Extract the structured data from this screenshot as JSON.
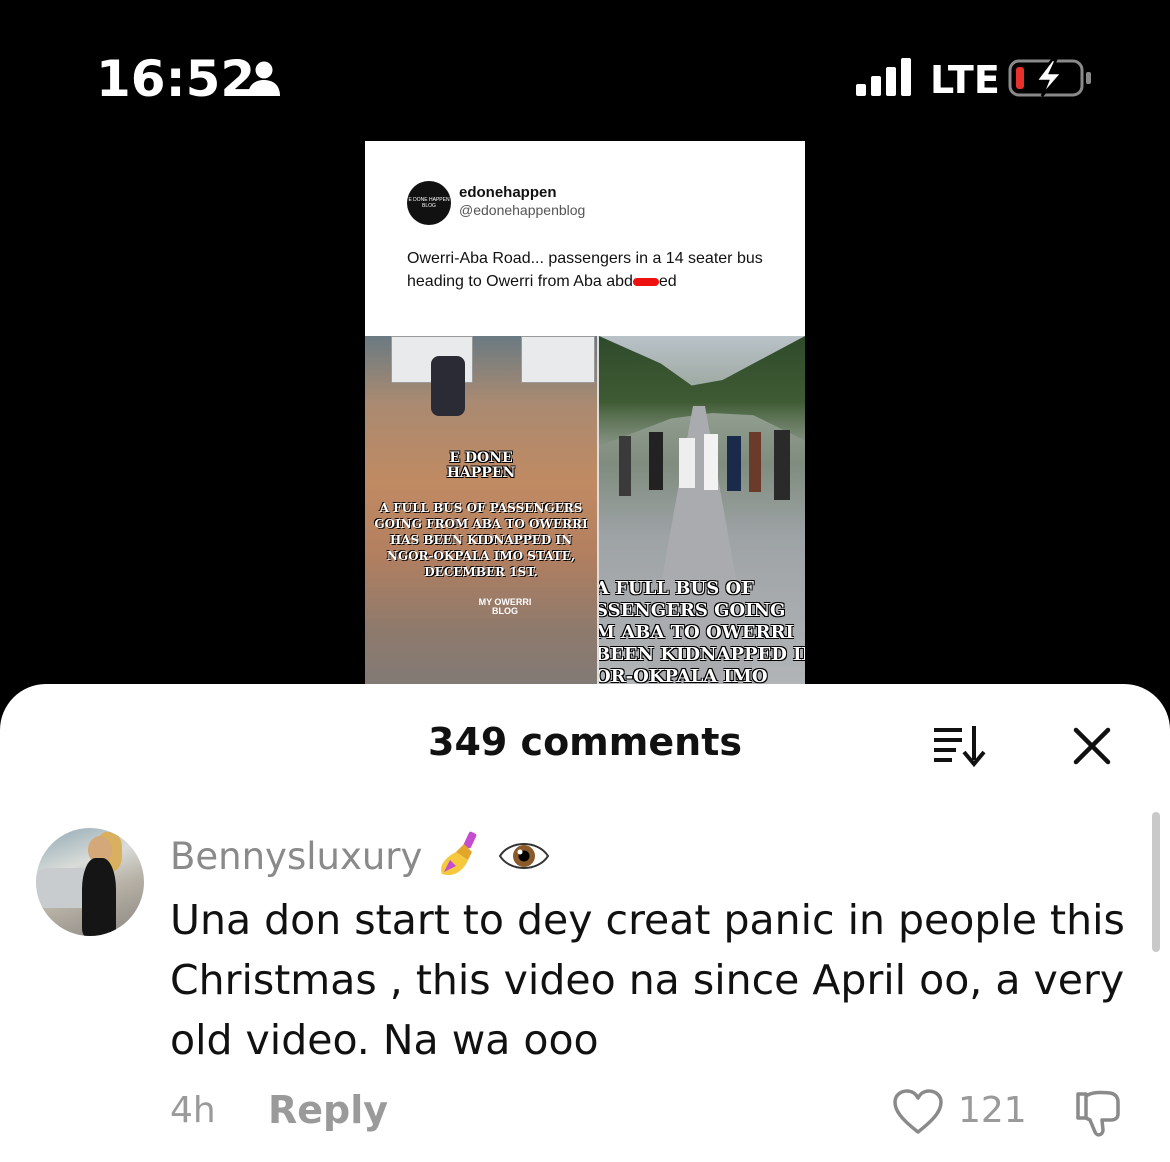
{
  "status_bar": {
    "time": "16:52",
    "network": "LTE",
    "icons": [
      "person-icon",
      "signal-icon",
      "battery-charging-icon"
    ]
  },
  "video": {
    "post": {
      "avatar_text": "E DONE HAPPEN BLOG",
      "name": "edonehappen",
      "handle": "@edonehappenblog",
      "text_before": "Owerri-Aba Road... passengers in a 14 seater bus heading to Owerri from Aba abd",
      "text_after": "ed"
    },
    "left_overlay_title": "E DONE HAPPEN",
    "left_overlay_text": "A FULL BUS OF PASSENGERS GOING FROM ABA TO OWERRI HAS BEEN KIDNAPPED IN NGOR-OKPALA IMO STATE, DECEMBER 1ST.",
    "watermark": "MY OWERRI BLOG",
    "right_overlay_lines": [
      "A FULL BUS OF",
      "SSENGERS GOING",
      "M ABA TO OWERRI",
      "BEEN KIDNAPPED IN",
      "OR-OKPALA IMO"
    ],
    "redaction_color": "#e11d1d"
  },
  "comments_sheet": {
    "title": "349 comments",
    "icons": [
      "sort-icon",
      "close-icon"
    ],
    "comment": {
      "username": "Bennysluxury",
      "emojis": [
        "nail-polish-emoji",
        "eye-emoji"
      ],
      "text": "Una don start to dey creat panic in people this Christmas , this video na since April oo, a very old video. Na wa ooo",
      "time": "4h",
      "reply_label": "Reply",
      "likes": "121"
    }
  }
}
